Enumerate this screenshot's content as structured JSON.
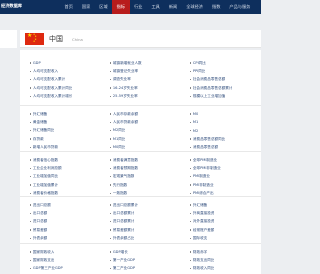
{
  "nav": {
    "brand": "经济数据库",
    "items": [
      "首页",
      "国家",
      "区域",
      "指标",
      "行业",
      "工具",
      "新闻",
      "全球经济",
      "指数",
      "产品与服务"
    ],
    "active_index": 3
  },
  "country": {
    "name_cn": "中国",
    "name_en": "China"
  },
  "sections": [
    {
      "rows": [
        [
          "GDP",
          "城镇新增就业人数",
          "CPI同比"
        ],
        [
          "人均可支配收入",
          "城镇登记失业率",
          "PPI同比"
        ],
        [
          "人均可支配收入累计",
          "调查失业率",
          "社会消费品零售总额"
        ],
        [
          "人均可支配收入累计同比",
          "16-24岁失业率",
          "社会消费品零售总额累计"
        ],
        [
          "人均可支配收入累计增长",
          "25-59岁失业率",
          "规模以上工业增加值"
        ]
      ]
    },
    {
      "rows": [
        [
          "外汇储备",
          "人民币存款余额",
          "M0"
        ],
        [
          "黄金储备",
          "人民币贷款余额",
          "M1"
        ],
        [
          "外汇储备同比",
          "M2同比",
          "M2"
        ],
        [
          "存贷款",
          "M1同比",
          "消费品零售总额同比"
        ],
        [
          "新增人民币贷款",
          "M0同比",
          "消费品零售总额"
        ]
      ]
    },
    {
      "rows": [
        [
          "消费者信心指数",
          "消费者满意指数",
          "全球PMI制造业"
        ],
        [
          "工业企业利润总额",
          "消费者预期指数",
          "全球PMI非制造业"
        ],
        [
          "工业增加值同比",
          "宏观景气指数",
          "PMI制造业"
        ],
        [
          "工业增加值累计",
          "先行指数",
          "PMI非制造业"
        ],
        [
          "消费者价格指数",
          "一致指数",
          "PMI综合产出"
        ]
      ]
    },
    {
      "rows": [
        [
          "进出口总额",
          "进出口总额累计",
          "外汇储备"
        ],
        [
          "出口总额",
          "出口总额累计",
          "外商直接投资"
        ],
        [
          "进口总额",
          "进口总额累计",
          "对外直接投资"
        ],
        [
          "贸易差额",
          "贸易差额累计",
          "经常账户差额"
        ],
        [
          "外债余额",
          "外债余额占比",
          "国际收支"
        ]
      ]
    },
    {
      "rows": [
        [
          "国家财政收入",
          "GDP增长",
          "财政赤字"
        ],
        [
          "国家财政支出",
          "第一产业GDP",
          "财政支出同比"
        ],
        [
          "GDP第三产业GDP",
          "第二产业GDP",
          "财政收入同比"
        ]
      ]
    }
  ]
}
